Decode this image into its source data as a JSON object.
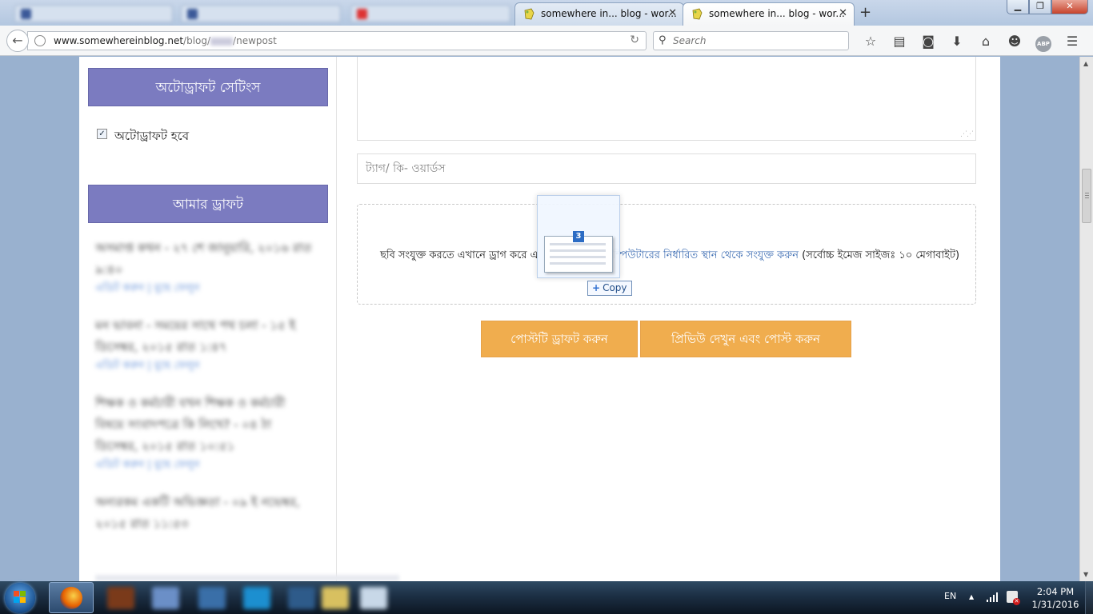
{
  "browser": {
    "tabs": [
      {
        "title": "somewhere in... blog - wor...",
        "active": false
      },
      {
        "title": "somewhere in... blog - wor...",
        "active": true
      }
    ],
    "url": {
      "host": "www.somewhereinblog.net",
      "prefix": "/blog/",
      "suffix": "/newpost"
    },
    "search_placeholder": "Search",
    "abp_label": "ABP"
  },
  "sidebar": {
    "autodraft_heading": "অটোড্রাফট সেটিংস",
    "autodraft_checkbox_label": "অটোড্রাফট হবে",
    "autodraft_checked": true,
    "drafts_heading": "আমার ড্রাফট",
    "drafts": [
      {
        "title": "অসমাপ্ত কথন - ২৭ শে জানুয়ারি, ২০১৬ রাত ৯:৪০",
        "meta": "এডিট করুন | মুছে ফেলুন"
      },
      {
        "title": "মন ভাবনা - সময়ের সাথে পথ চলা - ১৫ ই ডিসেম্বর, ২০১৫ রাত ১:৪৭",
        "meta": "এডিট করুন | মুছে ফেলুন"
      },
      {
        "title": "শিক্ষক ও কর্মচারী যখন শিক্ষক ও কর্মচারী বিষয়ে সংবাদপত্রে কি লিখে? - ০৪ ঠা ডিসেম্বর, ২০১৫ রাত ১০:৫১",
        "meta": "এডিট করুন | মুছে ফেলুন"
      },
      {
        "title": "অন্যরকম একটি অভিজ্ঞতা - ০৯ ই নভেম্বর, ২০১৫ রাত ১১:৫৩",
        "meta": ""
      }
    ]
  },
  "main": {
    "tags_placeholder": "ট্যাগ/ কি- ওয়ার্ডস",
    "dropzone_text_1": "ছবি সংযুক্ত করতে এখানে ড্রাগ করে এ",
    "dropzone_link": "কম্পিউটারের নির্ধারিত স্থান থেকে সংযুক্ত করুন",
    "dropzone_text_2": "(সর্বোচ্চ ইমেজ সাইজঃ ১০ মেগাবাইট)",
    "draft_button": "পোস্টটি ড্রাফট করুন",
    "preview_button": "প্রিভিউ দেখুন এবং পোস্ট করুন",
    "drag_count": "3",
    "drag_tooltip": "Copy"
  },
  "taskbar": {
    "language": "EN",
    "time": "2:04 PM",
    "date": "1/31/2016"
  },
  "colors": {
    "sidebar_heading_bg": "#7b7bc0",
    "button_bg": "#f0ad4e",
    "page_bg": "#99b1cf"
  }
}
